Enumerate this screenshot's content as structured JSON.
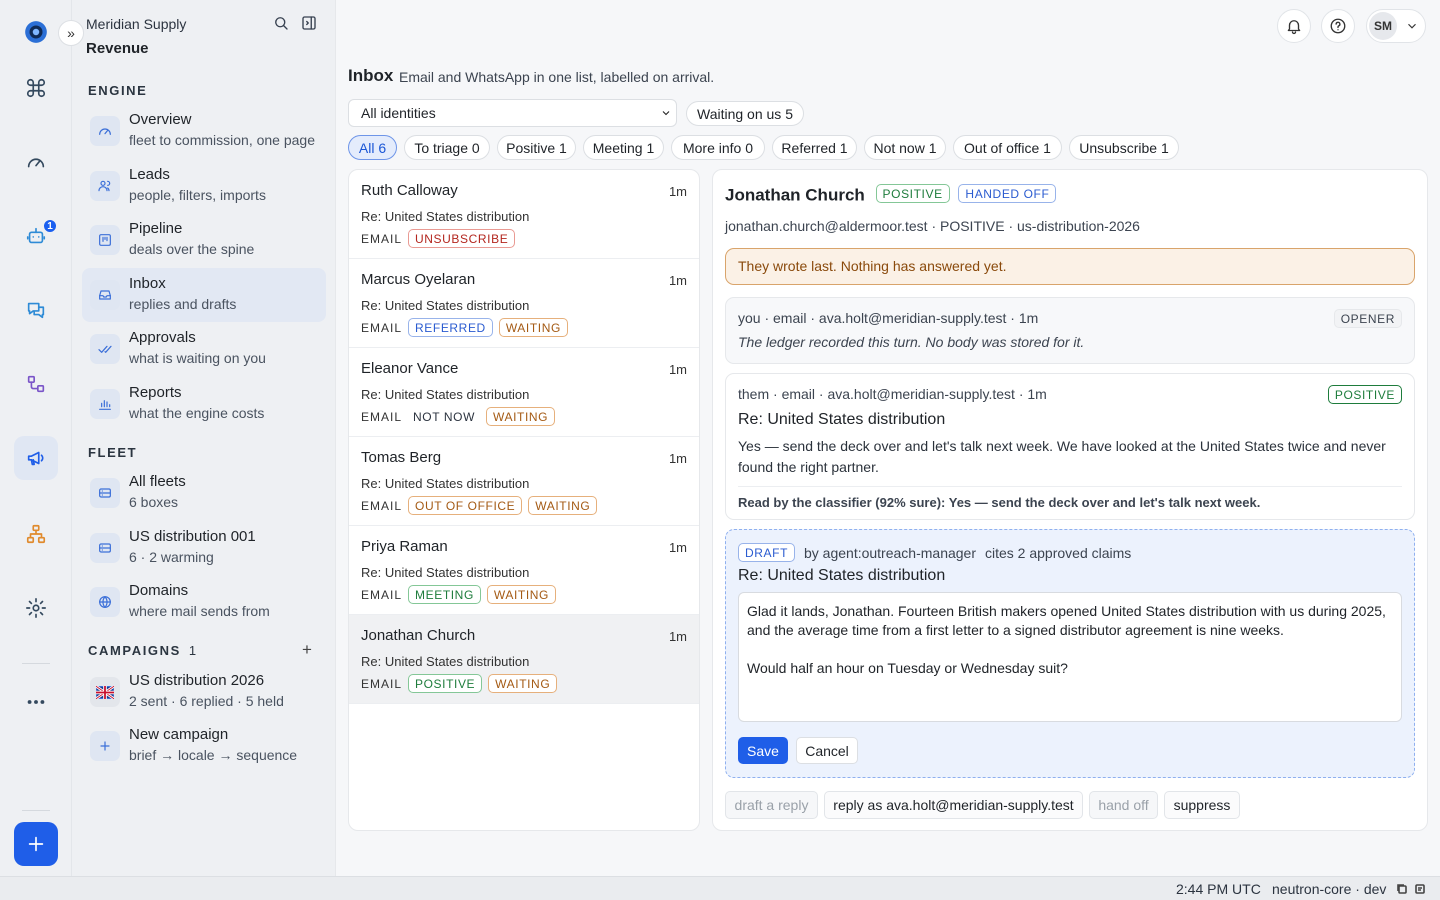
{
  "sidebar": {
    "org": "Meridian Supply",
    "workspace": "Revenue",
    "sections": {
      "engine": "ENGINE",
      "fleet": "FLEET",
      "campaigns": "CAMPAIGNS",
      "campaigns_count": "1"
    },
    "engine_items": [
      {
        "title": "Overview",
        "sub": "fleet to commission, one page"
      },
      {
        "title": "Leads",
        "sub": "people, filters, imports"
      },
      {
        "title": "Pipeline",
        "sub": "deals over the spine"
      },
      {
        "title": "Inbox",
        "sub": "replies and drafts"
      },
      {
        "title": "Approvals",
        "sub": "what is waiting on you"
      },
      {
        "title": "Reports",
        "sub": "what the engine costs"
      }
    ],
    "fleet_items": [
      {
        "title": "All fleets",
        "sub": "6 boxes"
      },
      {
        "title": "US distribution 001",
        "sub": "6 · 2 warming"
      },
      {
        "title": "Domains",
        "sub": "where mail sends from"
      }
    ],
    "campaign_items": [
      {
        "title": "US distribution 2026",
        "sub": "2 sent · 6 replied · 5 held"
      },
      {
        "title": "New campaign",
        "sub": "brief → locale → sequence"
      }
    ]
  },
  "rail": {
    "agents_badge": "1"
  },
  "header": {
    "avatar_initials": "SM"
  },
  "page": {
    "title": "Inbox",
    "subtitle": "Email and WhatsApp in one list, labelled on arrival."
  },
  "filters": {
    "identity_selected": "All identities",
    "waiting": "Waiting on us 5",
    "chips": [
      "All 6",
      "To triage 0",
      "Positive 1",
      "Meeting 1",
      "More info 0",
      "Referred 1",
      "Not now 1",
      "Out of office 1",
      "Unsubscribe 1"
    ]
  },
  "threads": [
    {
      "name": "Ruth Calloway",
      "time": "1m",
      "subject": "Re: United States distribution",
      "channel": "EMAIL",
      "tags": [
        "UNSUBSCRIBE"
      ]
    },
    {
      "name": "Marcus Oyelaran",
      "time": "1m",
      "subject": "Re: United States distribution",
      "channel": "EMAIL",
      "tags": [
        "REFERRED",
        "WAITING"
      ]
    },
    {
      "name": "Eleanor Vance",
      "time": "1m",
      "subject": "Re: United States distribution",
      "channel": "EMAIL",
      "tags": [
        "NOT NOW",
        "WAITING"
      ]
    },
    {
      "name": "Tomas Berg",
      "time": "1m",
      "subject": "Re: United States distribution",
      "channel": "EMAIL",
      "tags": [
        "OUT OF OFFICE",
        "WAITING"
      ]
    },
    {
      "name": "Priya Raman",
      "time": "1m",
      "subject": "Re: United States distribution",
      "channel": "EMAIL",
      "tags": [
        "MEETING",
        "WAITING"
      ]
    },
    {
      "name": "Jonathan Church",
      "time": "1m",
      "subject": "Re: United States distribution",
      "channel": "EMAIL",
      "tags": [
        "POSITIVE",
        "WAITING"
      ]
    }
  ],
  "detail": {
    "name": "Jonathan Church",
    "badges": [
      "POSITIVE",
      "HANDED OFF"
    ],
    "meta": "jonathan.church@aldermoor.test · POSITIVE · us-distribution-2026",
    "warning": "They wrote last. Nothing has answered yet.",
    "opener": {
      "meta": "you · email · ava.holt@meridian-supply.test · 1m",
      "badge": "OPENER",
      "note": "The ledger recorded this turn. No body was stored for it."
    },
    "reply": {
      "meta": "them · email · ava.holt@meridian-supply.test · 1m",
      "badge": "POSITIVE",
      "subject": "Re: United States distribution",
      "body": "Yes — send the deck over and let's talk next week. We have looked at the United States twice and never found the right partner.",
      "classifier": "Read by the classifier (92% sure): Yes — send the deck over and let's talk next week."
    },
    "draft": {
      "badge": "DRAFT",
      "by": "by agent:outreach-manager",
      "claims": "cites 2 approved claims",
      "subject": "Re: United States distribution",
      "para1": "Glad it lands, Jonathan. Fourteen British makers opened United States distribution with us during 2025, and the average time from a first letter to a signed distributor agreement is nine weeks.",
      "para2": "Would half an hour on Tuesday or Wednesday suit?",
      "save": "Save",
      "cancel": "Cancel"
    },
    "actions": {
      "draft": "draft a reply",
      "reply_as": "reply as ava.holt@meridian-supply.test",
      "hand_off": "hand off",
      "suppress": "suppress"
    }
  },
  "status": {
    "time": "2:44 PM UTC",
    "env": "neutron-core · dev"
  }
}
